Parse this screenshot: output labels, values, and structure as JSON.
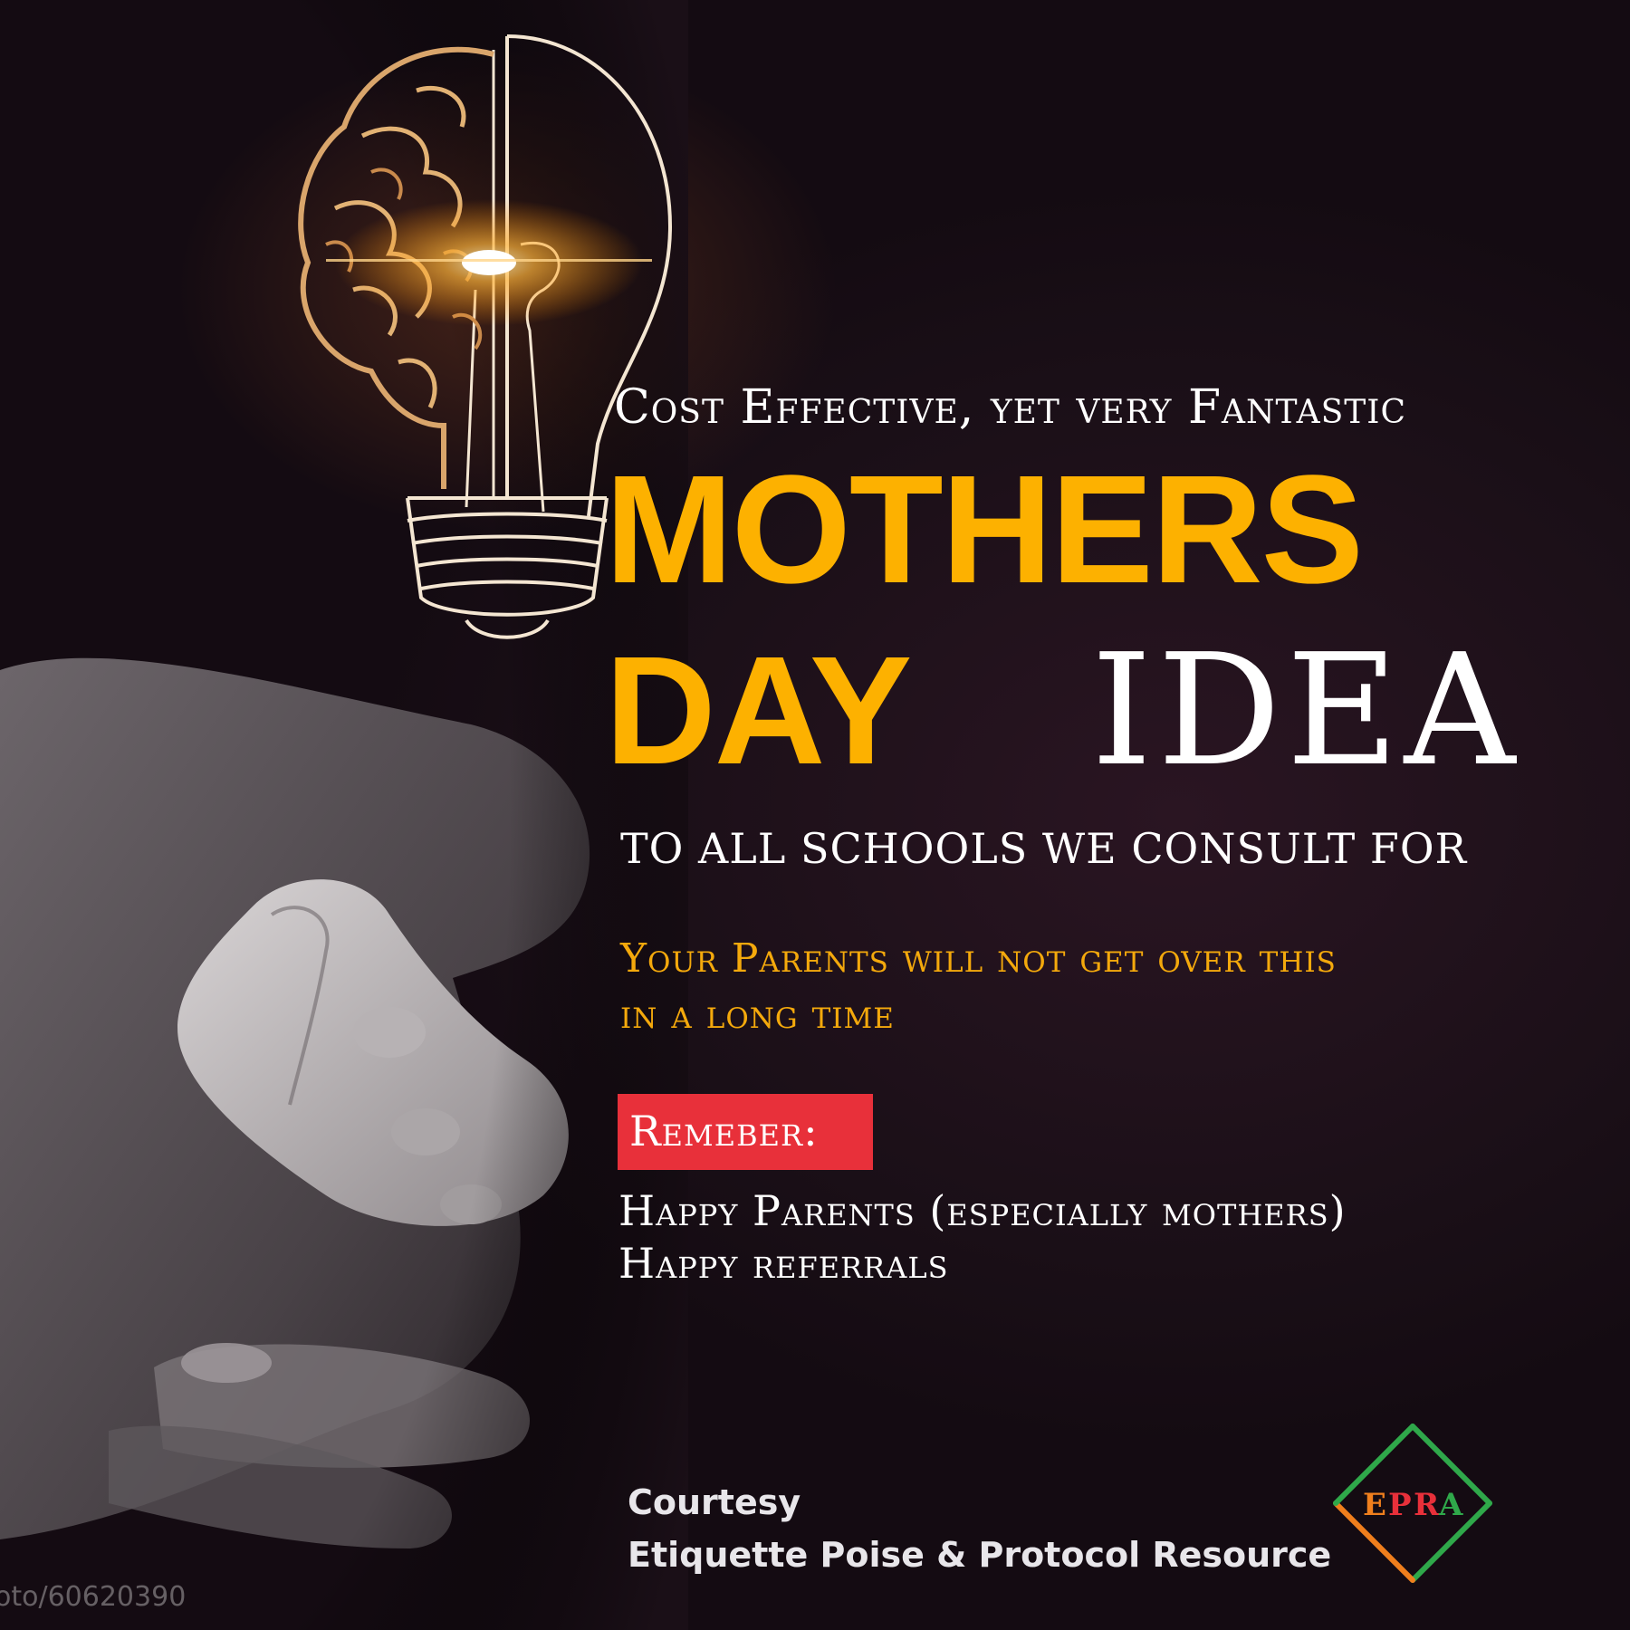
{
  "tagline": "Cost Effective, yet very Fantastic",
  "title": {
    "line1": "MOTHERS",
    "line2_a": "DAY",
    "line2_b": "IDEA"
  },
  "subline": "TO ALL SCHOOLS WE CONSULT FOR",
  "parents_message": {
    "line1": "Your Parents will not get over this",
    "line2": "in a long time"
  },
  "remember_label": "Remeber:",
  "happy": {
    "line1": "Happy Parents (especially mothers)",
    "line2": "Happy referrals"
  },
  "courtesy": {
    "label": "Courtesy",
    "org": "Etiquette Poise & Protocol Resource"
  },
  "logo": {
    "letters": [
      "E",
      "P",
      "R",
      "A"
    ],
    "colors": [
      "#f07f1d",
      "#e8303a",
      "#2fa84a"
    ]
  },
  "watermark": "oto/60620390",
  "colors": {
    "accent_yellow": "#fdb100",
    "remember_red": "#e8303a",
    "background": "#1a1116"
  }
}
